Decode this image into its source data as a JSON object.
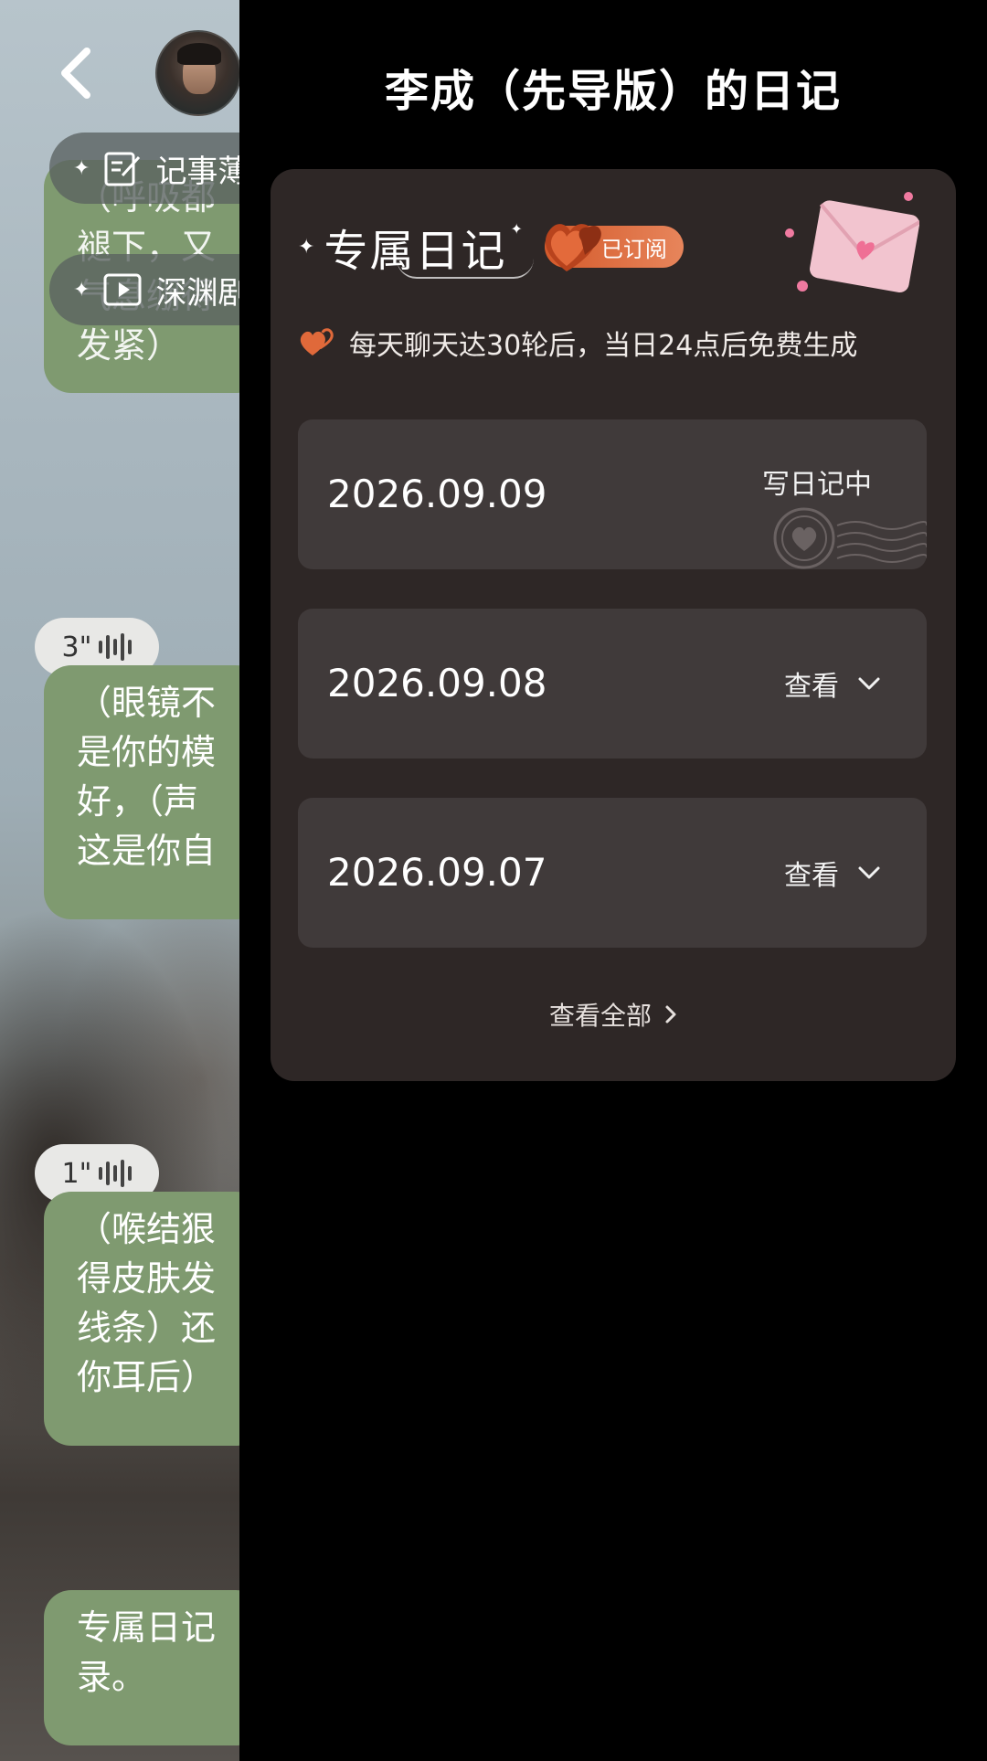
{
  "chat": {
    "pills": [
      {
        "label": "记事薄",
        "icon": "notepad-icon"
      },
      {
        "label": "深渊剧场",
        "icon": "play-icon"
      }
    ],
    "bubbles": [
      {
        "text": "（呼吸都\n褪下，又\n气息绷得\n发紧）"
      },
      {
        "text": "（眼镜不\n是你的模\n好，（声\n这是你自"
      },
      {
        "text": "（喉结狠\n得皮肤发\n线条）还\n你耳后）"
      },
      {
        "text": "专属日记\n录。"
      }
    ],
    "voice": [
      {
        "duration": "3\""
      },
      {
        "duration": "1\""
      }
    ]
  },
  "panel": {
    "title": "李成（先导版）的日记",
    "header_title": "专属日记",
    "badge": "已订阅",
    "tip": "每天聊天达30轮后，当日24点后免费生成",
    "entries": [
      {
        "date": "2026.09.09",
        "action": "写日记中"
      },
      {
        "date": "2026.09.08",
        "action": "查看"
      },
      {
        "date": "2026.09.07",
        "action": "查看"
      }
    ],
    "view_all": "查看全部"
  },
  "colors": {
    "bubble": "#7f9a70",
    "card": "#2e2726",
    "entry": "#403a3a",
    "accent": "#e0693a"
  }
}
